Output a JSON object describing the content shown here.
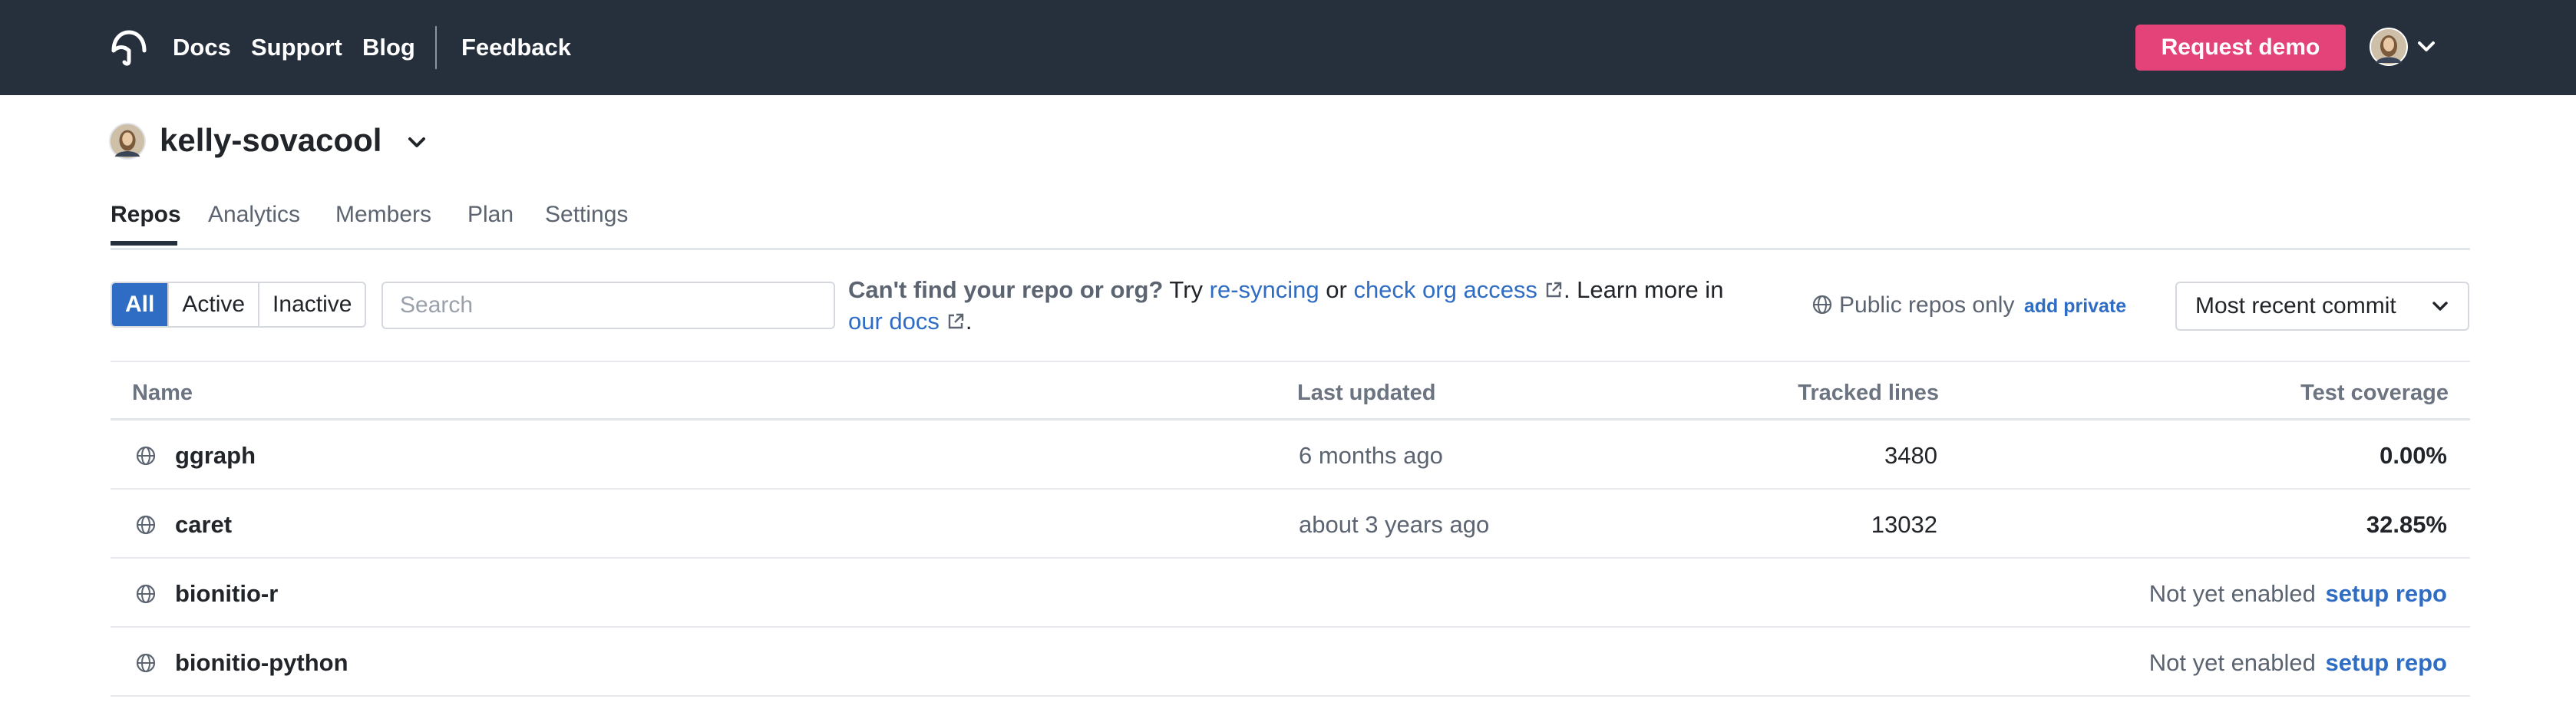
{
  "nav": {
    "logo_icon": "codecov-umbrella-icon",
    "links": [
      "Docs",
      "Support",
      "Blog"
    ],
    "feedback": "Feedback",
    "request_demo": "Request demo",
    "user_avatar_icon": "user-avatar",
    "user_menu_icon": "chevron-down-icon"
  },
  "org": {
    "name": "kelly-sovacool",
    "avatar_icon": "org-avatar",
    "menu_icon": "chevron-down-icon"
  },
  "tabs": [
    {
      "label": "Repos",
      "active": true
    },
    {
      "label": "Analytics",
      "active": false
    },
    {
      "label": "Members",
      "active": false
    },
    {
      "label": "Plan",
      "active": false
    },
    {
      "label": "Settings",
      "active": false
    }
  ],
  "filters": {
    "segments": [
      {
        "label": "All",
        "active": true
      },
      {
        "label": "Active",
        "active": false
      },
      {
        "label": "Inactive",
        "active": false
      }
    ],
    "search_placeholder": "Search",
    "search_value": ""
  },
  "help": {
    "question": "Can't find your repo or org?",
    "try": " Try ",
    "resync_link": "re-syncing",
    "or": " or ",
    "check_access_link": "check org access",
    "learn_more": ". Learn more in ",
    "docs_link": "our docs",
    "end": "."
  },
  "visibility": {
    "label": "Public repos only",
    "add_private": "add private"
  },
  "sort": {
    "selected": "Most recent commit"
  },
  "table": {
    "columns": {
      "name": "Name",
      "last_updated": "Last updated",
      "tracked_lines": "Tracked lines",
      "test_coverage": "Test coverage"
    },
    "rows": [
      {
        "name": "ggraph",
        "last_updated": "6 months ago",
        "tracked_lines": "3480",
        "test_coverage": "0.00%"
      },
      {
        "name": "caret",
        "last_updated": "about 3 years ago",
        "tracked_lines": "13032",
        "test_coverage": "32.85%"
      },
      {
        "name": "bionitio-r",
        "status": "Not yet enabled",
        "action": "setup repo"
      },
      {
        "name": "bionitio-python",
        "status": "Not yet enabled",
        "action": "setup repo"
      }
    ]
  },
  "colors": {
    "topbar": "#262f3c",
    "accent_pink": "#e34379",
    "link_blue": "#2f6dc4"
  }
}
